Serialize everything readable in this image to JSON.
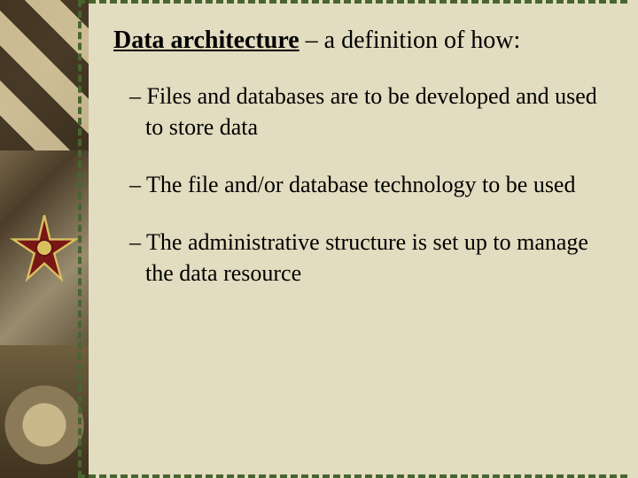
{
  "heading": {
    "term": "Data architecture",
    "rest": " – a definition of how:"
  },
  "bullets": [
    "– Files and databases are to be developed and used to store data",
    "– The file and/or database technology to be used",
    "– The administrative structure is set up to manage the data resource"
  ]
}
